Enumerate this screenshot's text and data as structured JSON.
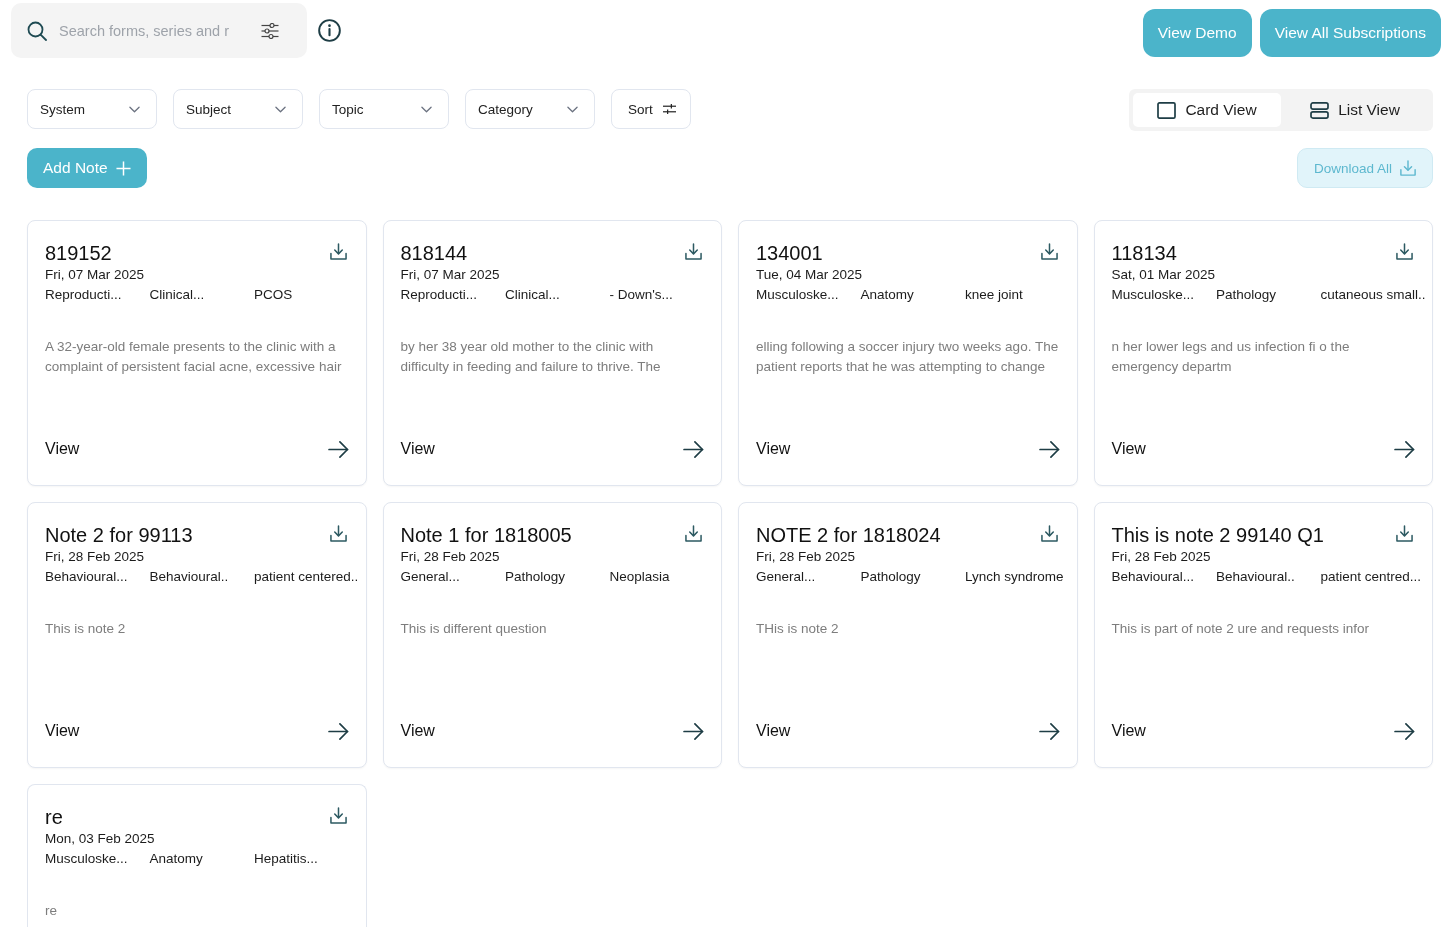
{
  "search": {
    "placeholder": "Search forms, series and r"
  },
  "header_buttons": [
    "View Demo",
    "View All Subscriptions"
  ],
  "filters": [
    {
      "label": "System"
    },
    {
      "label": "Subject"
    },
    {
      "label": "Topic"
    },
    {
      "label": "Category"
    }
  ],
  "sort": {
    "label": "Sort"
  },
  "view_toggle": [
    {
      "label": "Card View",
      "kind": "card",
      "selected": true
    },
    {
      "label": "List View",
      "kind": "list",
      "selected": false
    }
  ],
  "add_button": "Add Note",
  "download_all": "Download All",
  "cards": [
    {
      "title": "819152",
      "date": "Fri, 07 Mar 2025",
      "tags": [
        "Reproducti...",
        "Clinical...",
        "PCOS"
      ],
      "excerpt": "A 32-year-old female presents to the clinic with a complaint of persistent facial acne, excessive hair",
      "view": "View"
    },
    {
      "title": "818144",
      "date": "Fri, 07 Mar 2025",
      "tags": [
        "Reproducti...",
        "Clinical...",
        "- Down's..."
      ],
      "excerpt": "by her 38 year old mother to the clinic with difficulty in feeding and failure to thrive. The",
      "view": "View"
    },
    {
      "title": "134001",
      "date": "Tue, 04 Mar 2025",
      "tags": [
        "Musculoske...",
        "Anatomy",
        "knee joint"
      ],
      "excerpt": "elling following a soccer injury two weeks ago. The patient reports that he was attempting to change",
      "view": "View"
    },
    {
      "title": "118134",
      "date": "Sat, 01 Mar 2025",
      "tags": [
        "Musculoske...",
        "Pathology",
        "cutaneous small.."
      ],
      "excerpt": "n her lower legs and us infection fi o the emergency departm",
      "view": "View"
    },
    {
      "title": "Note 2 for 99113",
      "date": "Fri, 28 Feb 2025",
      "tags": [
        "Behavioural...",
        "Behavioural..",
        "patient centered.."
      ],
      "excerpt": "This is note 2",
      "view": "View"
    },
    {
      "title": "Note 1 for 1818005",
      "date": "Fri, 28 Feb 2025",
      "tags": [
        "General...",
        "Pathology",
        "Neoplasia"
      ],
      "excerpt": "This is different question",
      "view": "View"
    },
    {
      "title": "NOTE 2 for 1818024",
      "date": "Fri, 28 Feb 2025",
      "tags": [
        "General...",
        "Pathology",
        "Lynch syndrome"
      ],
      "excerpt": "THis is note 2",
      "view": "View"
    },
    {
      "title": "This is note 2 99140 Q1",
      "date": "Fri, 28 Feb 2025",
      "tags": [
        "Behavioural...",
        "Behavioural..",
        "patient centred..."
      ],
      "excerpt": "This is part of note 2 ure and requests infor",
      "view": "View"
    },
    {
      "title": "re",
      "date": "Mon, 03 Feb 2025",
      "tags": [
        "Musculoske...",
        "Anatomy",
        "Hepatitis..."
      ],
      "excerpt": "re"
    }
  ]
}
